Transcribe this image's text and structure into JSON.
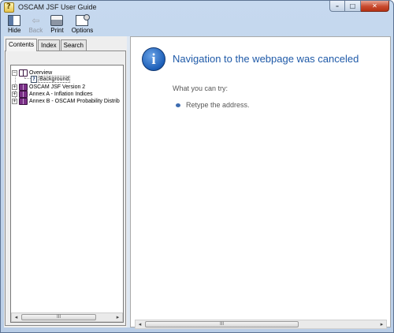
{
  "window": {
    "title": "OSCAM JSF User Guide",
    "caption_buttons": {
      "minimize": "–",
      "maximize": "□",
      "close": "✕"
    }
  },
  "toolbar": {
    "buttons": [
      {
        "label": "Hide",
        "icon": "hide-pane-icon",
        "enabled": true
      },
      {
        "label": "Back",
        "icon": "back-arrow-icon",
        "enabled": false
      },
      {
        "label": "Print",
        "icon": "printer-icon",
        "enabled": true
      },
      {
        "label": "Options",
        "icon": "options-icon",
        "enabled": true
      }
    ]
  },
  "nav": {
    "tabs": [
      {
        "label": "Contents",
        "active": true
      },
      {
        "label": "Index",
        "active": false
      },
      {
        "label": "Search",
        "active": false
      }
    ],
    "tree": [
      {
        "label": "Overview",
        "expander": "−",
        "icon": "open-book-icon"
      },
      {
        "label": "Background",
        "icon": "help-page-icon",
        "page_glyph": "?"
      },
      {
        "label": "OSCAM JSF Version 2",
        "expander": "+",
        "icon": "book-icon"
      },
      {
        "label": "Annex A - Inflation Indices",
        "expander": "+",
        "icon": "book-icon"
      },
      {
        "label": "Annex B - OSCAM Probability Distrib",
        "expander": "+",
        "icon": "book-icon"
      }
    ],
    "scroll_thumb": "III",
    "scroll_left": "◂",
    "scroll_right": "▸"
  },
  "content": {
    "info_glyph": "i",
    "heading": "Navigation to the webpage was canceled",
    "try_label": "What you can try:",
    "suggestion": "Retype the address.",
    "scroll_thumb": "III",
    "scroll_left": "◂",
    "scroll_right": "▸"
  },
  "colors": {
    "heading": "#1f5aa8",
    "frame": "#b9cde6",
    "close_button": "#c84a2e"
  }
}
